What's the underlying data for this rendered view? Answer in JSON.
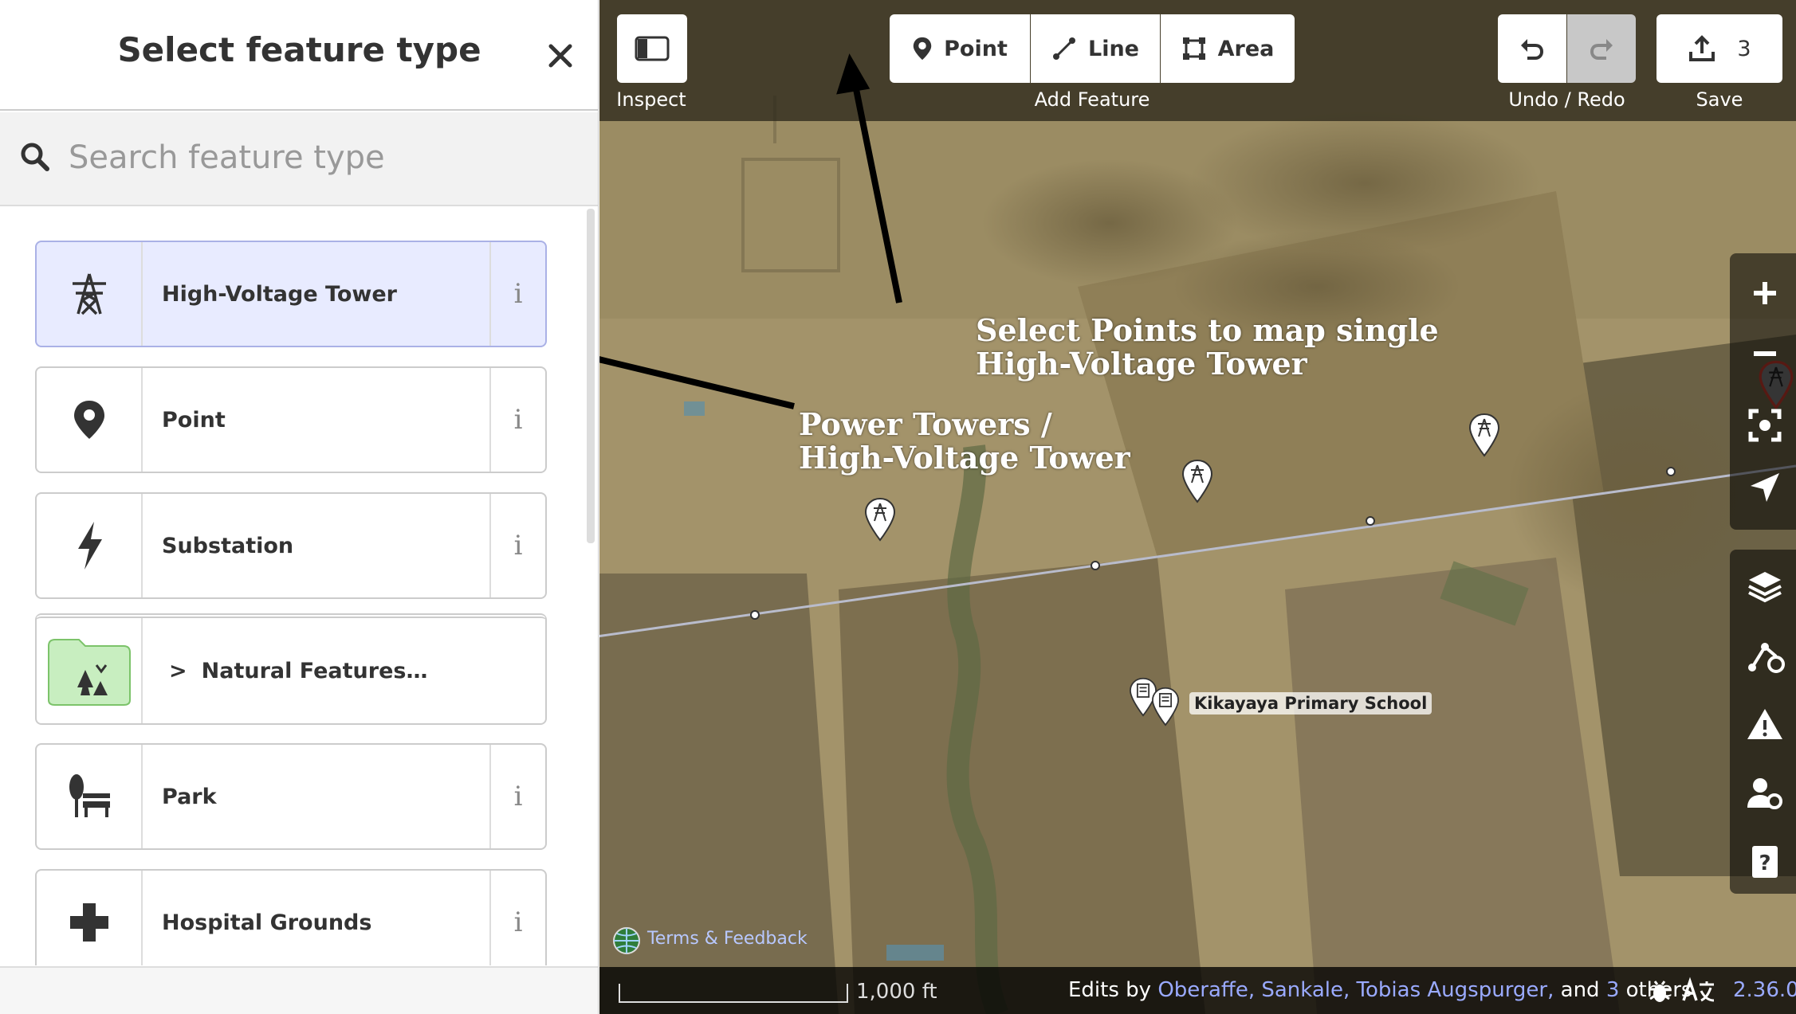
{
  "sidebar": {
    "title": "Select feature type",
    "search_placeholder": "Search feature type",
    "presets": [
      {
        "label": "High-Voltage Tower",
        "icon": "power-tower-icon",
        "selected": true,
        "info": "i"
      },
      {
        "label": "Point",
        "icon": "point-marker-icon",
        "info": "i"
      },
      {
        "label": "Substation",
        "icon": "lightning-icon",
        "info": "i"
      },
      {
        "label": "Natural Features…",
        "icon": "folder-nature-icon",
        "category": true,
        "chevron": ">"
      },
      {
        "label": "Park",
        "icon": "park-bench-icon",
        "info": "i"
      },
      {
        "label": "Hospital Grounds",
        "icon": "plus-icon",
        "info": "i"
      }
    ]
  },
  "toolbar": {
    "inspect_label": "Inspect",
    "point_label": "Point",
    "line_label": "Line",
    "area_label": "Area",
    "add_feature_label": "Add Feature",
    "undo_redo_label": "Undo / Redo",
    "save_label": "Save",
    "save_count": "3"
  },
  "map": {
    "annotation_point": "Select Points to map single\nHigh-Voltage Tower",
    "annotation_tower": "Power Towers /\nHigh-Voltage Tower",
    "school_label": "Kikayaya Primary School",
    "terms": "Terms & Feedback",
    "scale": "1,000 ft",
    "attribution_prefix": "Edits by",
    "attribution_users": "Oberaffe, Sankale, Tobias Augspurger,",
    "attribution_and": "and",
    "attribution_count": "3",
    "attribution_suffix": "others",
    "version": "2.36.0"
  },
  "colors": {
    "accent": "#7092ff",
    "selected": "#e8ebff"
  }
}
